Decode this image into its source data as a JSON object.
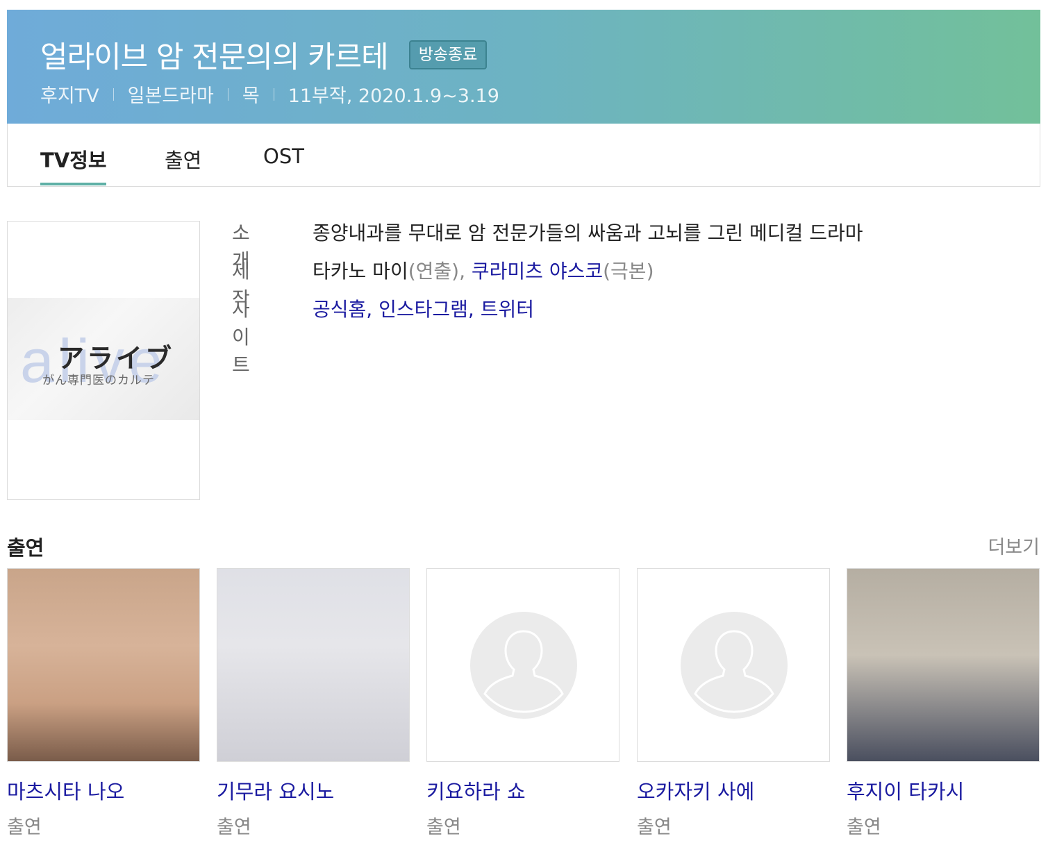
{
  "header": {
    "title": "얼라이브 암 전문의의 카르테",
    "status_badge": "방송종료",
    "meta": [
      "후지TV",
      "일본드라마",
      "목",
      "11부작, 2020.1.9~3.19"
    ]
  },
  "tabs": [
    {
      "label": "TV정보",
      "active": true
    },
    {
      "label": "출연",
      "active": false
    },
    {
      "label": "OST",
      "active": false
    }
  ],
  "poster": {
    "bg_word": "alive",
    "title": "アライブ",
    "subtitle": "がん専門医のカルテ"
  },
  "info": {
    "intro_label": "소개",
    "intro_value": "종양내과를 무대로 암 전문가들의 싸움과 고뇌를 그린 메디컬 드라마",
    "production_label": "제작",
    "production": {
      "director_name": "타카노 마이",
      "director_role": "(연출),",
      "writer_name": "쿠라미츠 야스코",
      "writer_role": "(극본)"
    },
    "site_label": "사이트",
    "sites": [
      "공식홈,",
      "인스타그램,",
      "트위터"
    ]
  },
  "cast_section": {
    "heading": "출연",
    "more": "더보기",
    "members": [
      {
        "name": "마츠시타 나오",
        "role": "출연"
      },
      {
        "name": "기무라 요시노",
        "role": "출연"
      },
      {
        "name": "키요하라 쇼",
        "role": "출연"
      },
      {
        "name": "오카자키 사에",
        "role": "출연"
      },
      {
        "name": "후지이 타카시",
        "role": "출연"
      }
    ]
  },
  "colors": {
    "header_gradient_start": "#6fabd9",
    "header_gradient_end": "#72c09a",
    "tab_underline": "#5fb0a6",
    "link": "#1a1aa0"
  }
}
